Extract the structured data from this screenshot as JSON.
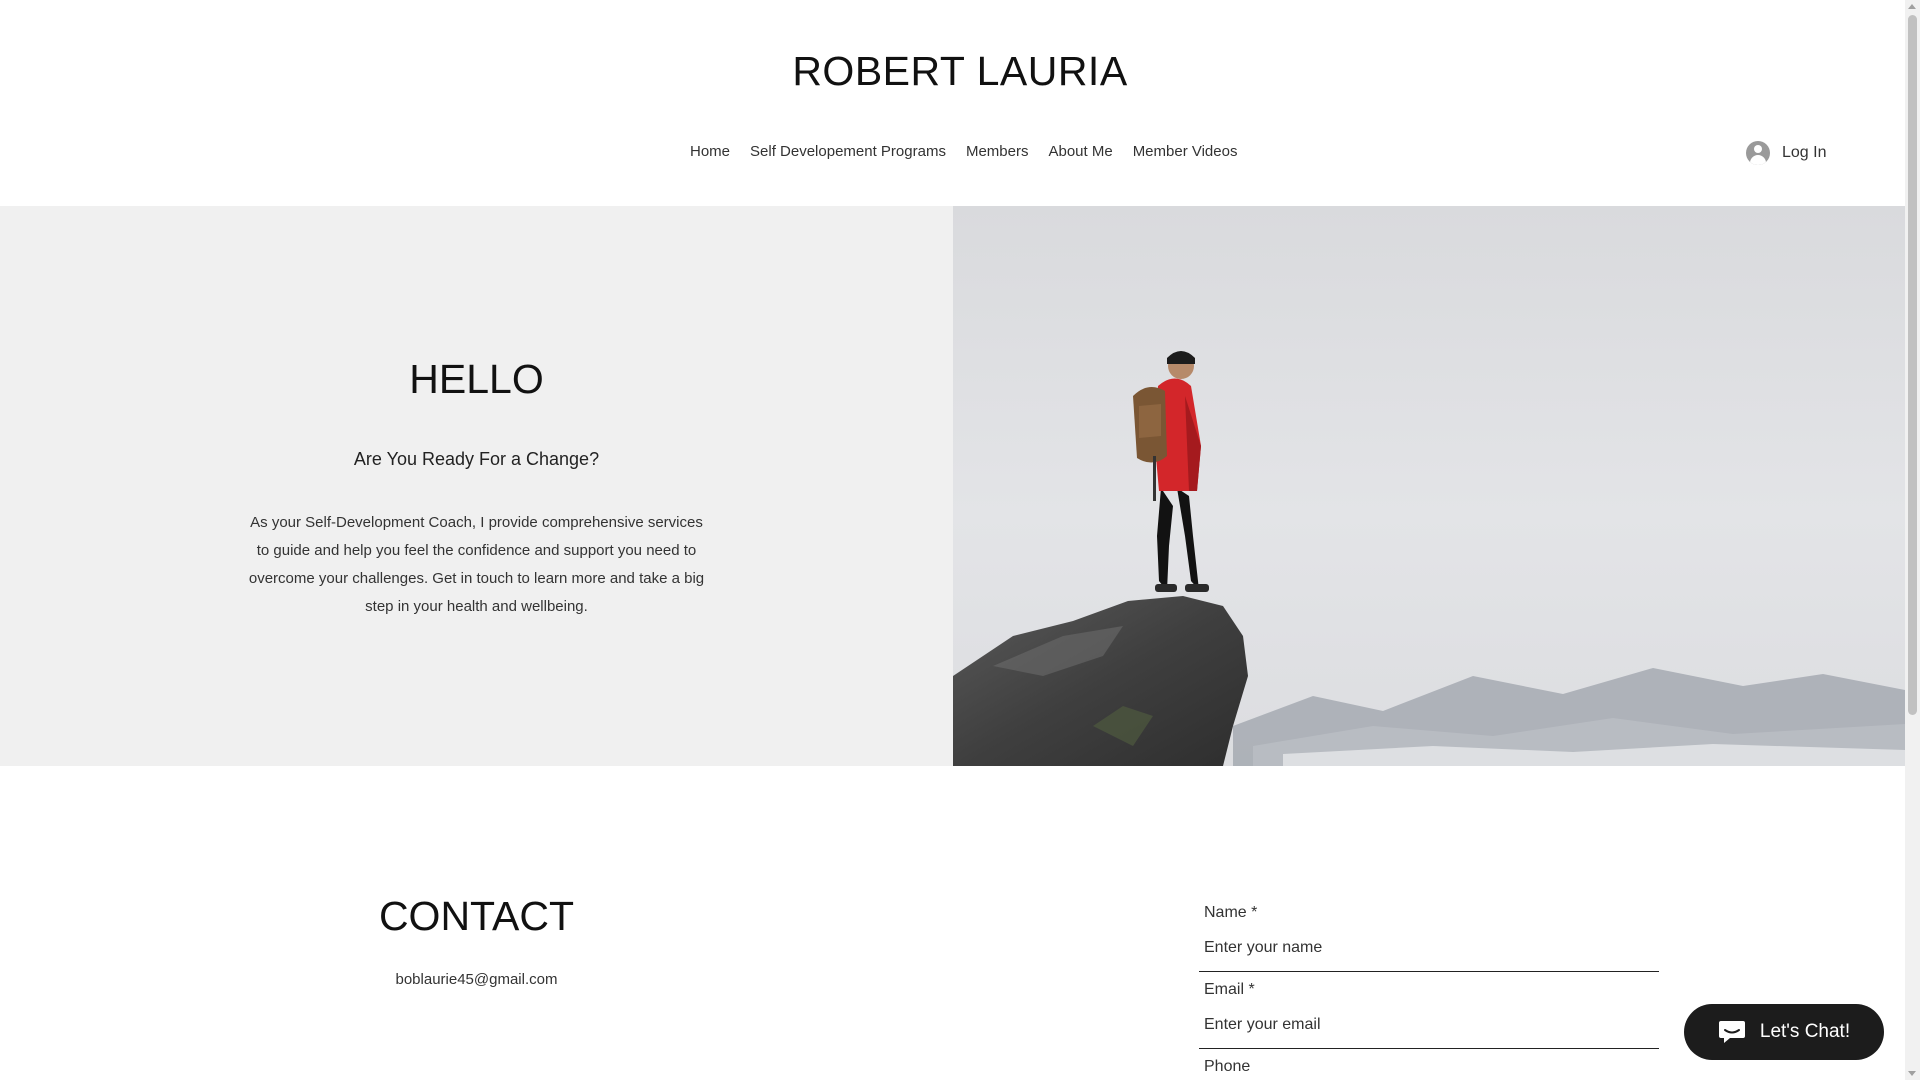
{
  "header": {
    "site_title": "ROBERT LAURIA",
    "nav": [
      {
        "label": "Home"
      },
      {
        "label": "Self Developement Programs"
      },
      {
        "label": "Members"
      },
      {
        "label": "About Me"
      },
      {
        "label": "Member Videos"
      }
    ],
    "login_label": "Log In"
  },
  "hero": {
    "heading": "HELLO",
    "subheading": "Are You Ready For a Change?",
    "body": "As your Self-Development Coach, I provide comprehensive services to guide and help you feel the confidence and support you need to overcome your challenges. Get in touch to learn more and take a big step in your health and wellbeing.",
    "image_icon": "hiker-on-cliff-image"
  },
  "contact": {
    "heading": "CONTACT",
    "email": "boblaurie45@gmail.com",
    "form": {
      "name_label": "Name *",
      "name_placeholder": "Enter your name",
      "email_label": "Email *",
      "email_placeholder": "Enter your email",
      "phone_label": "Phone"
    }
  },
  "chat": {
    "label": "Let's Chat!",
    "icon": "chat-bubble-icon"
  },
  "colors": {
    "hero_left_bg": "#f0f0f0",
    "chat_bg": "#1c1c1c"
  }
}
